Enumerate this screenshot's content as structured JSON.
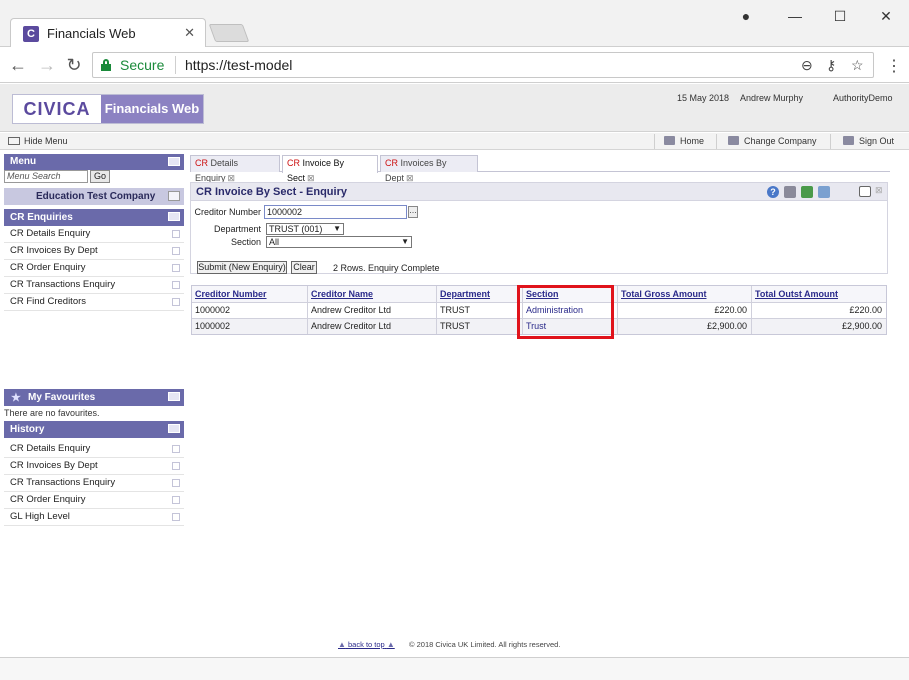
{
  "browser": {
    "tab_title": "Financials Web",
    "tab_favicon": "C",
    "secure_label": "Secure",
    "url": "https://test-model"
  },
  "header": {
    "logo_brand": "CIVICA",
    "logo_product": "Financials Web",
    "date": "15 May 2018",
    "user": "Andrew Murphy",
    "authority": "AuthorityDemo"
  },
  "strip": {
    "hide_menu": "Hide Menu",
    "home": "Home",
    "change_company": "Change Company",
    "sign_out": "Sign Out"
  },
  "sidebar": {
    "menu_title": "Menu",
    "search_placeholder": "Menu Search",
    "go_label": "Go",
    "company": "Education Test Company",
    "enquiries_title": "CR Enquiries",
    "enquiries": [
      "CR Details Enquiry",
      "CR Invoices By Dept",
      "CR Order Enquiry",
      "CR Transactions Enquiry",
      "CR Find Creditors"
    ],
    "favourites_title": "My Favourites",
    "no_favourites": "There are no favourites.",
    "history_title": "History",
    "history": [
      "CR Details Enquiry",
      "CR Invoices By Dept",
      "CR Transactions Enquiry",
      "CR Order Enquiry",
      "GL High Level"
    ]
  },
  "tabs": [
    {
      "prefix": "CR",
      "label": "Details Enquiry"
    },
    {
      "prefix": "CR",
      "label": "Invoice By Sect"
    },
    {
      "prefix": "CR",
      "label": "Invoices By Dept"
    }
  ],
  "panel": {
    "title": "CR Invoice By Sect - Enquiry",
    "creditor_label": "Creditor Number",
    "creditor_value": "1000002",
    "department_label": "Department",
    "department_value": "TRUST (001)",
    "section_label": "Section",
    "section_value": "All",
    "submit_label": "Submit (New Enquiry)",
    "clear_label": "Clear",
    "status": "2 Rows. Enquiry Complete"
  },
  "table": {
    "columns": [
      "Creditor Number",
      "Creditor Name",
      "Department",
      "Section",
      "Total Gross Amount",
      "Total Outst Amount"
    ],
    "rows": [
      [
        "1000002",
        "Andrew Creditor Ltd",
        "TRUST",
        "Administration",
        "£220.00",
        "£220.00"
      ],
      [
        "1000002",
        "Andrew Creditor Ltd",
        "TRUST",
        "Trust",
        "£2,900.00",
        "£2,900.00"
      ]
    ]
  },
  "footer": {
    "back_to_top": "back to top",
    "copyright": "© 2018 Civica UK Limited. All rights reserved."
  },
  "colors": {
    "accent": "#6a6aaa",
    "highlight": "#e0131b",
    "secure": "#1a8a3a"
  }
}
